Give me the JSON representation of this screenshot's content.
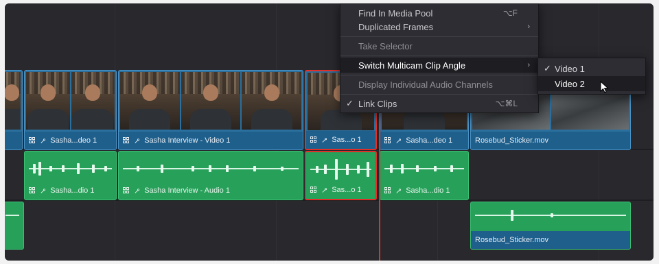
{
  "video_clips": [
    {
      "label": "Sasha...deo 1"
    },
    {
      "label": "Sasha Interview - Video 1"
    },
    {
      "label": "Sas...o 1"
    },
    {
      "label": "Sasha...deo 1"
    },
    {
      "label": "Rosebud_Sticker.mov"
    }
  ],
  "audio_clips": [
    {
      "label": "Sasha...dio 1"
    },
    {
      "label": "Sasha Interview - Audio 1"
    },
    {
      "label": "Sas...o 1"
    },
    {
      "label": "Sasha...dio 1"
    }
  ],
  "audio2_clips": [
    {
      "label": "Rosebud_Sticker.mov"
    }
  ],
  "context_menu": {
    "items": [
      {
        "label": "Find In Media Pool",
        "shortcut": "⌥F"
      },
      {
        "label": "Duplicated Frames",
        "submenu": "›"
      },
      {
        "label": "Take Selector"
      },
      {
        "label": "Switch Multicam Clip Angle",
        "submenu": "›"
      },
      {
        "label": "Display Individual Audio Channels"
      },
      {
        "label": "Link Clips",
        "check": "✓",
        "shortcut": "⌥⌘L"
      }
    ]
  },
  "submenu": {
    "items": [
      {
        "label": "Video 1",
        "check": "✓"
      },
      {
        "label": "Video 2"
      }
    ]
  },
  "colors": {
    "video_clip": "#2a6f9e",
    "audio_clip": "#27a05a",
    "selection": "#e0302a",
    "playhead": "#e0302a",
    "menu_bg": "#2d2d33"
  },
  "icons": {
    "multicam": "multicam-icon",
    "link": "link-icon",
    "check": "checkmark-icon",
    "submenu_arrow": "chevron-right-icon",
    "cursor": "mouse-pointer-icon"
  }
}
